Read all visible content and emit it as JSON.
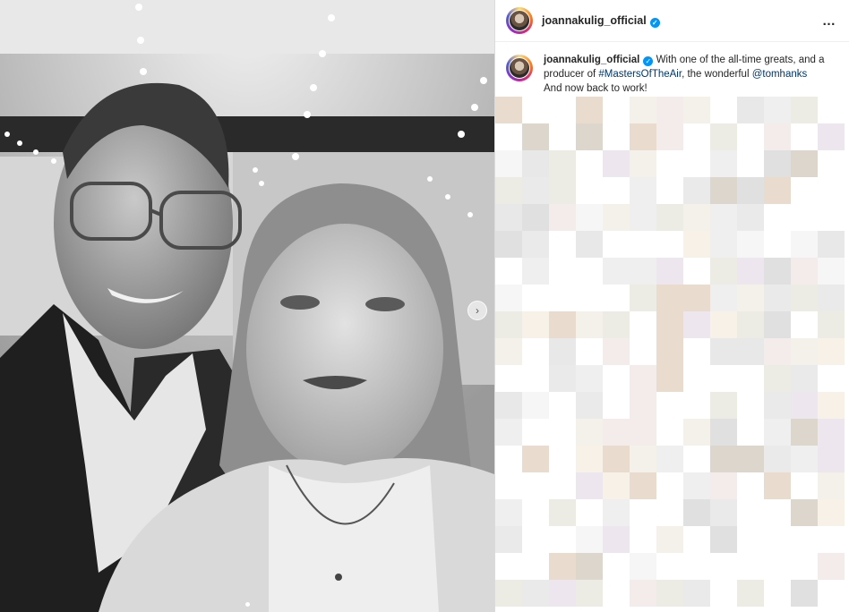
{
  "post": {
    "username": "joannakulig_official",
    "more_icon": "…",
    "verified_icon": "✓",
    "caption": {
      "username": "joannakulig_official",
      "line1": "With one of the all-time greats, and a",
      "line2_prefix": "producer of",
      "hashtag": "#MastersOfTheAir",
      "line2_middle": ", the wonderful",
      "mention": "@tomhanks",
      "line3": "And now back to work!"
    },
    "carousel": {
      "next_icon": "›",
      "dot_count": 1
    }
  },
  "colors": {
    "verified": "#0095f6",
    "link": "#00376b",
    "border": "#dbdbdb"
  }
}
